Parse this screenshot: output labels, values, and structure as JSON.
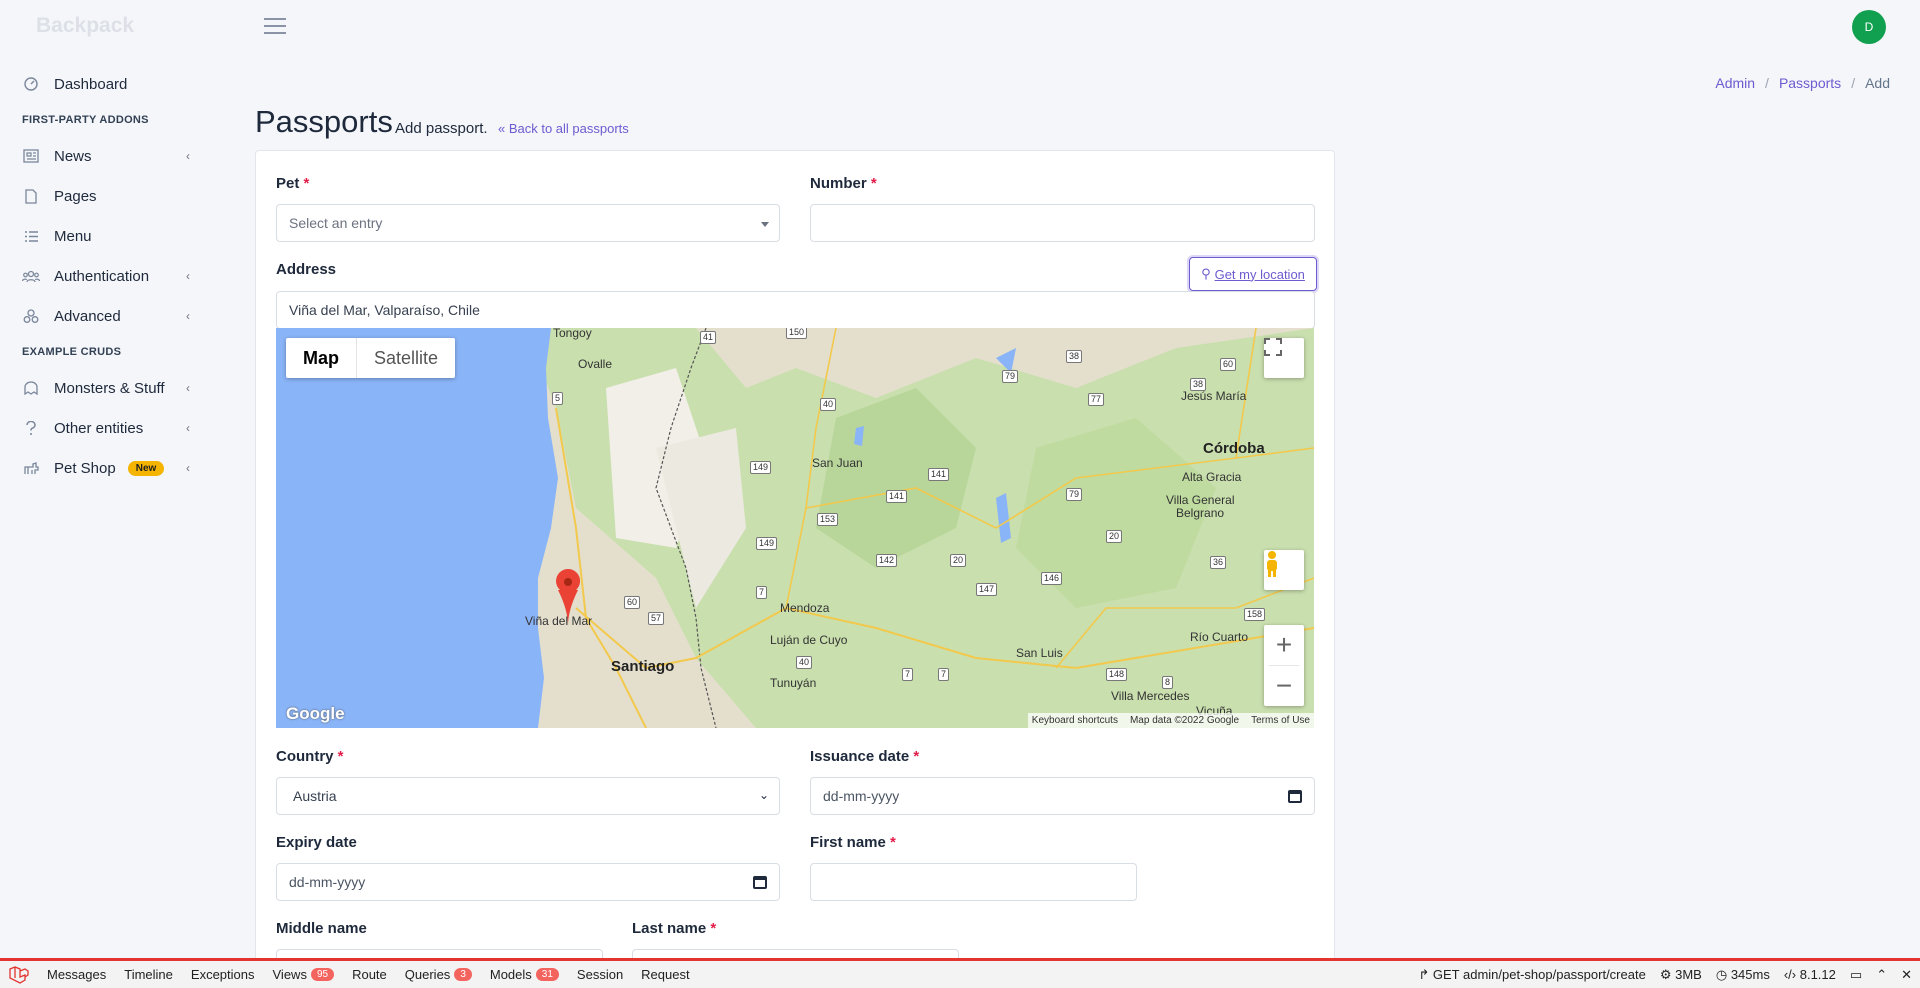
{
  "header": {
    "brand": "Backpack",
    "avatar_initial": "D"
  },
  "breadcrumb": [
    "Admin",
    "Passports",
    "Add"
  ],
  "sidebar": {
    "items": [
      {
        "label": "Dashboard",
        "icon": "gauge-icon"
      },
      {
        "heading": "FIRST-PARTY ADDONS"
      },
      {
        "label": "News",
        "icon": "newspaper-icon",
        "chevron": true
      },
      {
        "label": "Pages",
        "icon": "file-icon"
      },
      {
        "label": "Menu",
        "icon": "list-icon"
      },
      {
        "label": "Authentication",
        "icon": "users-icon",
        "chevron": true
      },
      {
        "label": "Advanced",
        "icon": "cogs-icon",
        "chevron": true
      },
      {
        "heading": "EXAMPLE CRUDS"
      },
      {
        "label": "Monsters & Stuff",
        "icon": "ghost-icon",
        "chevron": true
      },
      {
        "label": "Other entities",
        "icon": "question-icon",
        "chevron": true
      },
      {
        "label": "Pet Shop",
        "icon": "dog-icon",
        "badge": "New",
        "chevron": true
      }
    ]
  },
  "page": {
    "title": "Passports",
    "subtitle": "Add passport.",
    "back_link": "Back to all passports"
  },
  "form": {
    "pet": {
      "label": "Pet",
      "placeholder": "Select an entry"
    },
    "number": {
      "label": "Number",
      "value": ""
    },
    "address": {
      "label": "Address",
      "value": "Viña del Mar, Valparaíso, Chile",
      "geo_button": "Get my location"
    },
    "country": {
      "label": "Country",
      "value": "Austria"
    },
    "issuance_date": {
      "label": "Issuance date",
      "placeholder": "dd-mm-yyyy"
    },
    "expiry_date": {
      "label": "Expiry date",
      "placeholder": "dd-mm-yyyy"
    },
    "first_name": {
      "label": "First name"
    },
    "middle_name": {
      "label": "Middle name"
    },
    "last_name": {
      "label": "Last name"
    }
  },
  "map": {
    "type_map": "Map",
    "type_satellite": "Satellite",
    "footer": [
      "Keyboard shortcuts",
      "Map data ©2022 Google",
      "Terms of Use"
    ],
    "logo": "Google",
    "cities": {
      "vina": "Viña del Mar",
      "santiago": "Santiago",
      "mendoza": "Mendoza",
      "lujan": "Luján de Cuyo",
      "tunuyan": "Tunuyán",
      "sanjuan": "San Juan",
      "cordoba": "Córdoba",
      "altagracia": "Alta Gracia",
      "villagb1": "Villa General",
      "villagb2": "Belgrano",
      "jesusmaria": "Jesús María",
      "riocuarto": "Río Cuarto",
      "sanluis": "San Luis",
      "villamercedes": "Villa Mercedes",
      "vicuna": "Vicuña",
      "ovalle": "Ovalle",
      "tongoy": "Tongoy"
    },
    "roads": [
      "41",
      "150",
      "150",
      "38",
      "60",
      "79",
      "77",
      "38",
      "5",
      "40",
      "149",
      "141",
      "141",
      "79",
      "153",
      "149",
      "20",
      "142",
      "20",
      "36",
      "146",
      "147",
      "60",
      "57",
      "158",
      "7",
      "40",
      "7",
      "7",
      "148",
      "8"
    ]
  },
  "debugbar": {
    "tabs": [
      {
        "label": "Messages"
      },
      {
        "label": "Timeline"
      },
      {
        "label": "Exceptions"
      },
      {
        "label": "Views",
        "count": "95"
      },
      {
        "label": "Route"
      },
      {
        "label": "Queries",
        "count": "3"
      },
      {
        "label": "Models",
        "count": "31"
      },
      {
        "label": "Session"
      },
      {
        "label": "Request"
      }
    ],
    "request": "GET admin/pet-shop/passport/create",
    "memory": "3MB",
    "time": "345ms",
    "php": "8.1.12"
  }
}
